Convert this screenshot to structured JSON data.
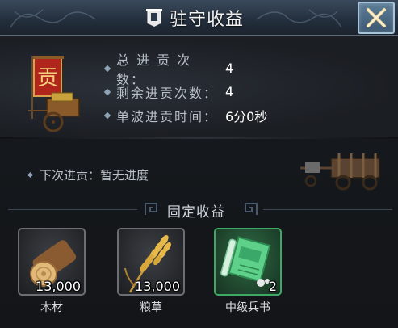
{
  "window": {
    "title": "驻守收益",
    "close_icon": "close-x-icon"
  },
  "stats": [
    {
      "label": "总 进 贡 次 数：",
      "value": "4"
    },
    {
      "label": "剩余进贡次数：",
      "value": "4"
    },
    {
      "label": "单波进贡时间：",
      "value": "6分0秒"
    }
  ],
  "next_tribute": {
    "label": "下次进贡：",
    "value": "暂无进度"
  },
  "fixed_income": {
    "title": "固定收益",
    "items": [
      {
        "name": "木材",
        "quantity": "13,000",
        "icon": "wood-log-icon"
      },
      {
        "name": "粮草",
        "quantity": "13,000",
        "icon": "wheat-icon"
      },
      {
        "name": "中级兵书",
        "quantity": "2",
        "icon": "scroll-book-icon"
      }
    ]
  },
  "tribute_badge_text": "贡",
  "colors": {
    "title_bar": "#2b3a4a",
    "green_frame": "#3fa864",
    "grey_frame": "#6b6f75",
    "close_button": "#4a6985"
  }
}
